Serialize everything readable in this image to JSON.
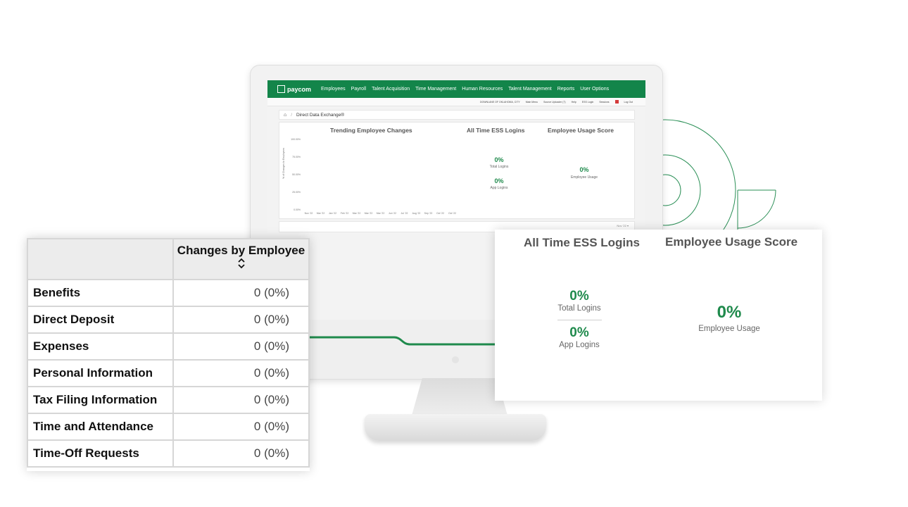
{
  "colors": {
    "brand_green": "#13854a",
    "value_green": "#1f8a4c"
  },
  "app": {
    "logo_text": "paycom",
    "nav": [
      "Employees",
      "Payroll",
      "Talent Acquisition",
      "Time Management",
      "Human Resources",
      "Talent Management",
      "Reports",
      "User Options"
    ],
    "subbar": [
      "DOWNLANE OF OKLAHOMA, CITY",
      "Main Menu",
      "Source Uploader (7)",
      "Help",
      "ESS Login",
      "Sessions",
      "Log Out"
    ],
    "breadcrumb": "Direct Data Exchange®",
    "trending_title": "Trending Employee Changes",
    "y_axis_label": "% of Changes to Employees",
    "y_ticks": [
      "100.00%",
      "75.00%",
      "50.00%",
      "25.00%",
      "0.00%"
    ],
    "x_ticks": [
      "Nov '22",
      "Mar '22",
      "Jan '22",
      "Feb '22",
      "Mar '22",
      "Mar '22",
      "Mar '22",
      "Jun '22",
      "Jul '22",
      "Aug '22",
      "Sep '22",
      "Oct '22",
      "Oct '22"
    ],
    "ess_title": "All Time ESS Logins",
    "total_logins_value": "0%",
    "total_logins_label": "Total Logins",
    "app_logins_value": "0%",
    "app_logins_label": "App Logins",
    "usage_title": "Employee Usage Score",
    "usage_value": "0%",
    "usage_label": "Employee Usage",
    "dropdown_text": "Nov '22"
  },
  "changes_table": {
    "column_header": "Changes by Employee",
    "rows": [
      {
        "label": "Benefits",
        "value": "0 (0%)"
      },
      {
        "label": "Direct Deposit",
        "value": "0 (0%)"
      },
      {
        "label": "Expenses",
        "value": "0 (0%)"
      },
      {
        "label": "Personal Information",
        "value": "0 (0%)"
      },
      {
        "label": "Tax Filing Information",
        "value": "0 (0%)"
      },
      {
        "label": "Time and Attendance",
        "value": "0 (0%)"
      },
      {
        "label": "Time-Off Requests",
        "value": "0 (0%)"
      }
    ]
  },
  "ess_card": {
    "logins_title": "All Time ESS Logins",
    "total_logins_value": "0%",
    "total_logins_label": "Total Logins",
    "app_logins_value": "0%",
    "app_logins_label": "App Logins",
    "usage_title": "Employee Usage Score",
    "usage_value": "0%",
    "usage_label": "Employee Usage"
  }
}
